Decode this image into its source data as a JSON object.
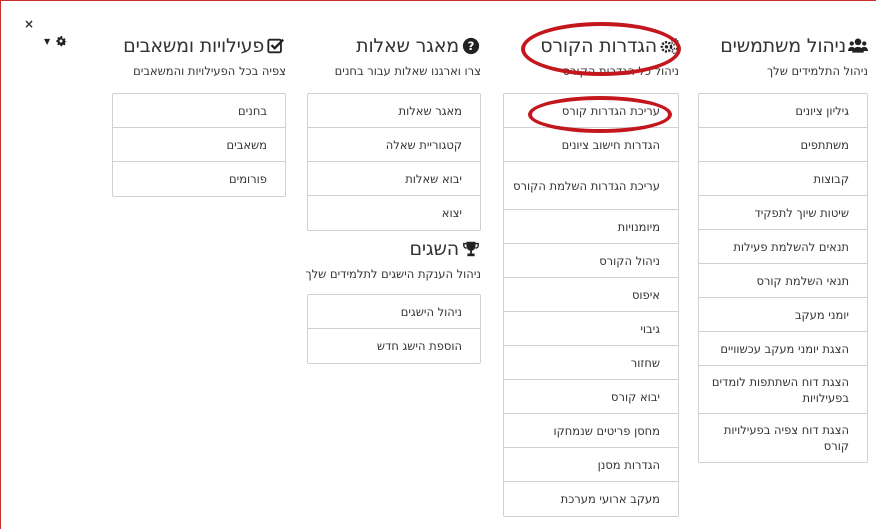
{
  "controls": {
    "close_label": "×"
  },
  "user_management": {
    "title": "ניהול משתמשים",
    "subtitle": "ניהול התלמידים שלך",
    "items": [
      {
        "label": "גיליון ציונים"
      },
      {
        "label": "משתתפים"
      },
      {
        "label": "קבוצות"
      },
      {
        "label": "שיטות שיוך לתפקיד"
      },
      {
        "label": "תנאים להשלמת פעילות"
      },
      {
        "label": "תנאי השלמת קורס"
      },
      {
        "label": "יומני מעקב"
      },
      {
        "label": "הצגת יומני מעקב עכשוויים"
      },
      {
        "label": "הצגת דוח השתתפות לומדים בפעילויות"
      },
      {
        "label": "הצגת דוח צפיה בפעילויות קורס"
      }
    ]
  },
  "course_settings": {
    "title": "הגדרות הקורס",
    "subtitle": "ניהול כל הגדרות הקורס",
    "items": [
      {
        "label": "עריכת הגדרות קורס"
      },
      {
        "label": "הגדרות חישוב ציונים"
      },
      {
        "label": "עריכת הגדרות השלמת הקורס"
      },
      {
        "label": "מיומנויות"
      },
      {
        "label": "ניהול הקורס"
      },
      {
        "label": "איפוס"
      },
      {
        "label": "גיבוי"
      },
      {
        "label": "שחזור"
      },
      {
        "label": "יבוא קורס"
      },
      {
        "label": "מחסן פריטים שנמחקו"
      },
      {
        "label": "הגדרות מסנן"
      },
      {
        "label": "מעקב ארועי מערכת"
      }
    ]
  },
  "question_bank": {
    "title": "מאגר שאלות",
    "subtitle": "צרו וארגנו שאלות עבור בחנים",
    "items": [
      {
        "label": "מאגר שאלות"
      },
      {
        "label": "קטגוריית שאלה"
      },
      {
        "label": "יבוא שאלות"
      },
      {
        "label": "יצוא"
      }
    ]
  },
  "badges": {
    "title": "השגים",
    "subtitle": "ניהול הענקת הישגים לתלמידים שלך",
    "items": [
      {
        "label": "ניהול הישגים"
      },
      {
        "label": "הוספת הישג חדש"
      }
    ]
  },
  "activities": {
    "title": "פעילויות ומשאבים",
    "subtitle": "צפיה בכל הפעילויות והמשאבים",
    "items": [
      {
        "label": "בחנים"
      },
      {
        "label": "משאבים"
      },
      {
        "label": "פורומים"
      }
    ]
  },
  "icons": {
    "users": "users-icon",
    "settings": "gears-icon",
    "question": "question-circle-icon",
    "trophy": "trophy-icon",
    "checkbox": "check-square-icon",
    "gear": "gear-icon"
  },
  "colors": {
    "highlight": "#c3171d",
    "border": "#d0d0d0",
    "frame": "#c9302c"
  }
}
